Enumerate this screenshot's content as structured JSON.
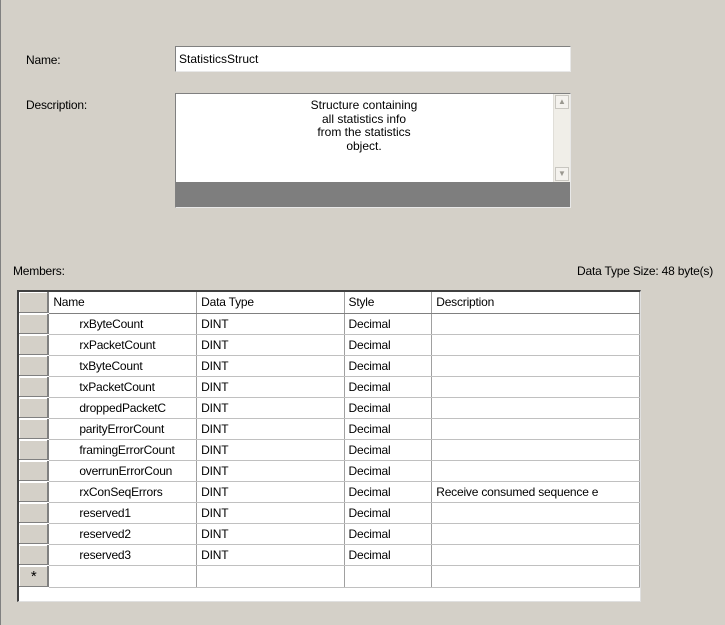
{
  "form": {
    "name_label": "Name:",
    "name_value": "StatisticsStruct",
    "description_label": "Description:",
    "description_value": "Structure containing\nall statistics info\nfrom the statistics\nobject.",
    "members_label": "Members:",
    "data_type_size": "Data Type Size: 48 byte(s)"
  },
  "table": {
    "columns": [
      "Name",
      "Data Type",
      "Style",
      "Description"
    ],
    "new_row_marker": "*",
    "rows": [
      {
        "name": "rxByteCount",
        "data_type": "DINT",
        "style": "Decimal",
        "description": ""
      },
      {
        "name": "rxPacketCount",
        "data_type": "DINT",
        "style": "Decimal",
        "description": ""
      },
      {
        "name": "txByteCount",
        "data_type": "DINT",
        "style": "Decimal",
        "description": ""
      },
      {
        "name": "txPacketCount",
        "data_type": "DINT",
        "style": "Decimal",
        "description": ""
      },
      {
        "name": "droppedPacketC",
        "data_type": "DINT",
        "style": "Decimal",
        "description": ""
      },
      {
        "name": "parityErrorCount",
        "data_type": "DINT",
        "style": "Decimal",
        "description": ""
      },
      {
        "name": "framingErrorCount",
        "data_type": "DINT",
        "style": "Decimal",
        "description": ""
      },
      {
        "name": "overrunErrorCoun",
        "data_type": "DINT",
        "style": "Decimal",
        "description": ""
      },
      {
        "name": "rxConSeqErrors",
        "data_type": "DINT",
        "style": "Decimal",
        "description": "Receive consumed sequence e"
      },
      {
        "name": "reserved1",
        "data_type": "DINT",
        "style": "Decimal",
        "description": ""
      },
      {
        "name": "reserved2",
        "data_type": "DINT",
        "style": "Decimal",
        "description": ""
      },
      {
        "name": "reserved3",
        "data_type": "DINT",
        "style": "Decimal",
        "description": ""
      }
    ]
  }
}
